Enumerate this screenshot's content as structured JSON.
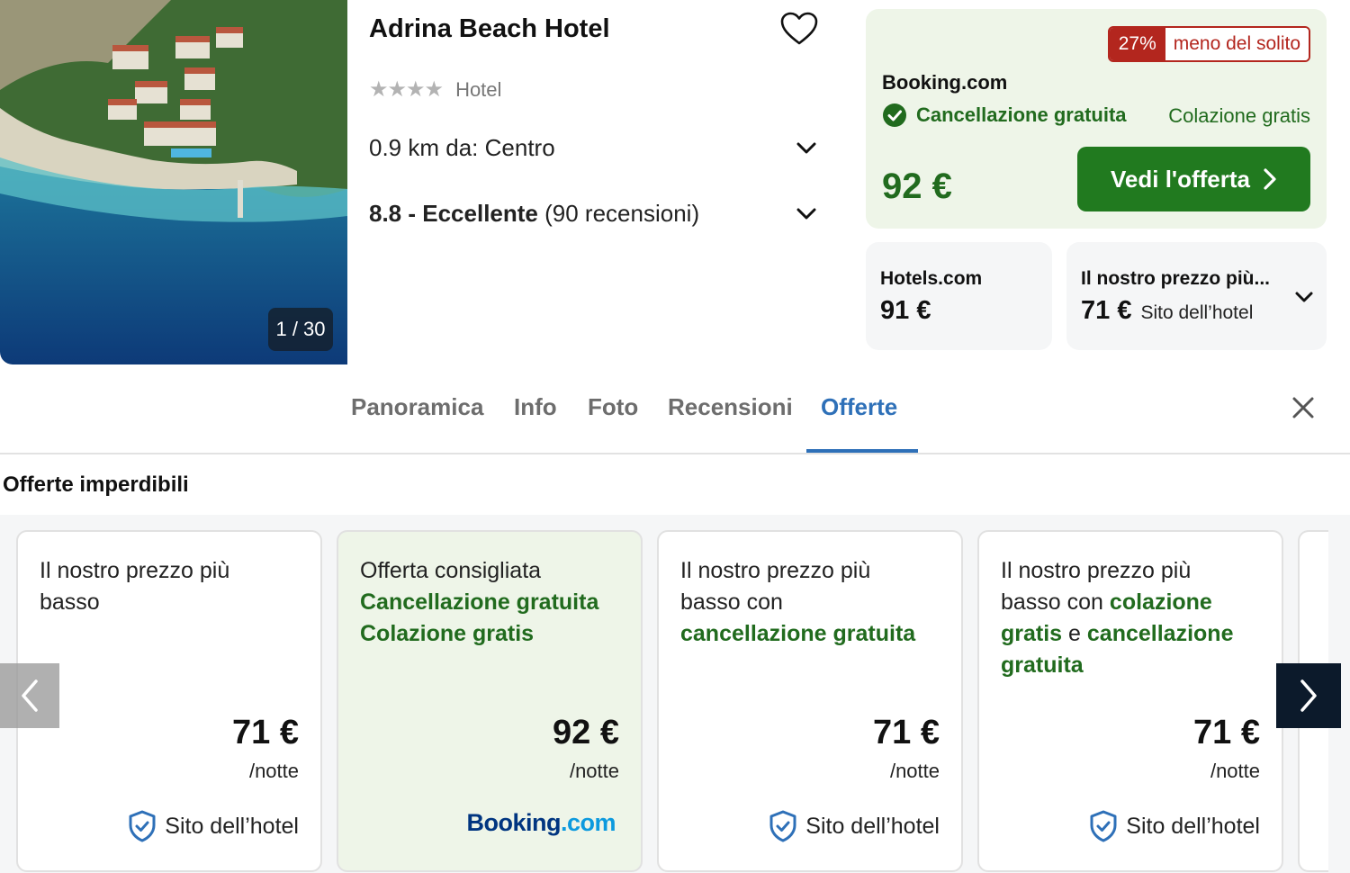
{
  "hotel": {
    "name": "Adrina Beach Hotel",
    "stars": "★★★★",
    "type": "Hotel",
    "distance": "0.9 km da: Centro",
    "rating_score": "8.8 - Eccellente",
    "rating_reviews": "(90 recensioni)",
    "photo_counter": "1 / 30"
  },
  "main_offer": {
    "discount_pct": "27%",
    "discount_text": "meno del solito",
    "provider": "Booking.com",
    "free_cancel": "Cancellazione gratuita",
    "breakfast": "Colazione gratis",
    "price": "92 €",
    "cta_label": "Vedi l'offerta"
  },
  "alt_offers": [
    {
      "provider": "Hotels.com",
      "price": "91 €",
      "site": ""
    },
    {
      "provider": "Il nostro prezzo più...",
      "price": "71 €",
      "site": "Sito dell’hotel"
    }
  ],
  "tabs": [
    "Panoramica",
    "Info",
    "Foto",
    "Recensioni",
    "Offerte"
  ],
  "active_tab": "Offerte",
  "section_title": "Offerte imperdibili",
  "deals": [
    {
      "line1": "Il nostro prezzo più",
      "line2": "basso",
      "price": "71 €",
      "per": "/notte",
      "site": "Sito dell’hotel"
    },
    {
      "line1": "Offerta consigliata",
      "green1": "Cancellazione gratuita",
      "green2": "Colazione gratis",
      "price": "92 €",
      "per": "/notte",
      "logo_main": "Booking",
      "logo_dot": ".com"
    },
    {
      "line1": "Il nostro prezzo più",
      "line2": "basso con",
      "green1": "cancellazione gratuita",
      "price": "71 €",
      "per": "/notte",
      "site": "Sito dell’hotel"
    },
    {
      "line1": "Il nostro prezzo più",
      "line2": "basso con",
      "green1": "colazione",
      "green2": "gratis",
      "mid": "e",
      "green3": "cancellazione",
      "green4": "gratuita",
      "price": "71 €",
      "per": "/notte",
      "site": "Sito dell’hotel"
    }
  ],
  "colors": {
    "green": "#216b1e",
    "cta_green": "#217a1f",
    "blue": "#2e70b8",
    "red": "#b3261e",
    "offer_bg": "#eef5e8"
  },
  "icons": [
    "heart-icon",
    "chevron-down-icon",
    "check-circle-icon",
    "chevron-right-icon",
    "close-icon",
    "shield-check-icon",
    "arrow-left-icon",
    "arrow-right-icon"
  ]
}
